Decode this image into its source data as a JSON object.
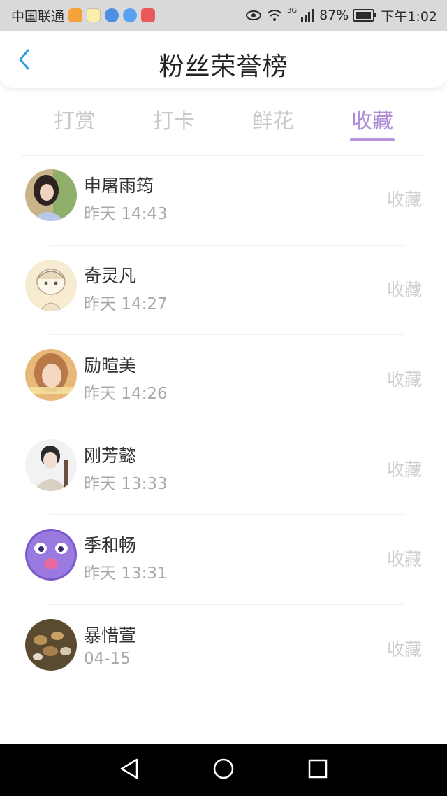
{
  "status_bar": {
    "carrier": "中国联通",
    "network": "3G",
    "battery": "87%",
    "time": "下午1:02"
  },
  "header": {
    "title": "粉丝荣誉榜"
  },
  "tabs": [
    {
      "label": "打赏",
      "active": false
    },
    {
      "label": "打卡",
      "active": false
    },
    {
      "label": "鲜花",
      "active": false
    },
    {
      "label": "收藏",
      "active": true
    }
  ],
  "fans": [
    {
      "name": "申屠雨筠",
      "time": "昨天 14:43",
      "action": "收藏"
    },
    {
      "name": "奇灵凡",
      "time": "昨天 14:27",
      "action": "收藏"
    },
    {
      "name": "励暄美",
      "time": "昨天 14:26",
      "action": "收藏"
    },
    {
      "name": "刚芳懿",
      "time": "昨天 13:33",
      "action": "收藏"
    },
    {
      "name": "季和畅",
      "time": "昨天 13:31",
      "action": "收藏"
    },
    {
      "name": "暴惜萱",
      "time": "04-15",
      "action": "收藏"
    }
  ],
  "colors": {
    "accent": "#b08bd6",
    "back_arrow": "#2a9ee6",
    "inactive_tab": "#c9c9c9"
  },
  "icons": {
    "back": "chevron-left-icon",
    "nav": [
      "back-triangle-icon",
      "home-circle-icon",
      "recents-square-icon"
    ]
  }
}
